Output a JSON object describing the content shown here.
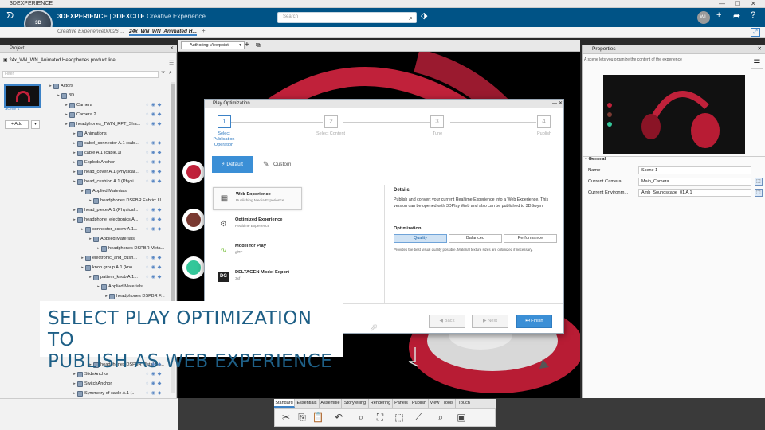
{
  "window": {
    "title": "3DEXPERIENCE",
    "controls": [
      "—",
      "☐",
      "✕"
    ]
  },
  "topbar": {
    "brand_main": "3DEXPERIENCE",
    "brand_sep": " | ",
    "brand_app": "3DEXCITE",
    "brand_sub": " Creative Experience",
    "search_placeholder": "Search",
    "compass_title": "3D",
    "compass_version": "V.R",
    "user_initials": "WL"
  },
  "doc_tabs": [
    {
      "label": "Creative Experience00026 ..."
    },
    {
      "label": "24x_WN_WN_Animated H..."
    }
  ],
  "doc_tab_add": "+",
  "left_panel": {
    "title": "Project",
    "root": "24x_WN_WN_Animated Headphones product line",
    "scene_label": "Scene 1",
    "add_label": "+ Add",
    "filter_placeholder": "Filter"
  },
  "tree": [
    {
      "label": "Actors",
      "indent": 0,
      "icons": ""
    },
    {
      "label": "3D",
      "indent": 1,
      "icons": ""
    },
    {
      "label": "Camera",
      "indent": 2,
      "icons": "◌◉◆"
    },
    {
      "label": "Camera 2",
      "indent": 2,
      "icons": "◌◉◆"
    },
    {
      "label": "headphones_TWIN_RPT_Sha...",
      "indent": 2,
      "icons": "◌◉◆"
    },
    {
      "label": "Animations",
      "indent": 3,
      "icons": ""
    },
    {
      "label": "cabel_connector A.1 (cab...",
      "indent": 3,
      "icons": "◌◉◆"
    },
    {
      "label": "cable A.1 (cable.1)",
      "indent": 3,
      "icons": "◌◉◆"
    },
    {
      "label": "ExplodeAnchor",
      "indent": 3,
      "icons": "◌◉◆"
    },
    {
      "label": "head_cover A.1 (Physical...",
      "indent": 3,
      "icons": "◌◉◆"
    },
    {
      "label": "head_cushion A.1 (Physi...",
      "indent": 3,
      "icons": "◌◉◆"
    },
    {
      "label": "Applied Materials",
      "indent": 4,
      "icons": ""
    },
    {
      "label": "headphones DSPBR Fabric: U...",
      "indent": 5,
      "icons": ""
    },
    {
      "label": "head_piece A.1 (Physical...",
      "indent": 3,
      "icons": "◌◉◆"
    },
    {
      "label": "headphone_electronics A...",
      "indent": 3,
      "icons": "◌◉◆"
    },
    {
      "label": "connector_screw A.1...",
      "indent": 4,
      "icons": "◌◉◆"
    },
    {
      "label": "Applied Materials",
      "indent": 5,
      "icons": ""
    },
    {
      "label": "headphones DSPBR Meta...",
      "indent": 6,
      "icons": ""
    },
    {
      "label": "electronic_and_cush...",
      "indent": 4,
      "icons": "◌◉◆"
    },
    {
      "label": "knob group A.1 (kno...",
      "indent": 4,
      "icons": "◌◉◆"
    },
    {
      "label": "pattern_knob A.1...",
      "indent": 5,
      "icons": "◌◉◆"
    },
    {
      "label": "Applied Materials",
      "indent": 6,
      "icons": ""
    },
    {
      "label": "headphones DSPBR F...",
      "indent": 7,
      "icons": ""
    }
  ],
  "tree_bottom": [
    {
      "label": "headphones DSPBR Metal Sa...",
      "indent": 5,
      "icons": "◌◉◆"
    },
    {
      "label": "SlideAnchor",
      "indent": 3,
      "icons": "◌◉◆"
    },
    {
      "label": "SwitchAnchor",
      "indent": 3,
      "icons": "◌◉◆"
    },
    {
      "label": "Symmetry of cable A.1 (...",
      "indent": 3,
      "icons": "◌◉◆"
    }
  ],
  "viewport": {
    "viewpoint_label": "Authoring Viewpoint"
  },
  "properties": {
    "title": "Properties",
    "hint": "A scene lets you organize the content of the experience",
    "section": "General",
    "rows": [
      {
        "label": "Name",
        "value": "Scene 1"
      },
      {
        "label": "Current Camera",
        "value": "Main_Camera"
      },
      {
        "label": "Current Environm...",
        "value": "Amb_Soundscape_01 A.1"
      }
    ]
  },
  "dialog": {
    "title": "Play Optimization",
    "steps": [
      {
        "num": "1",
        "label": "Select Publication Operation"
      },
      {
        "num": "2",
        "label": "Select Content"
      },
      {
        "num": "3",
        "label": "Tune"
      },
      {
        "num": "4",
        "label": "Publish"
      }
    ],
    "mode_default": "Default",
    "mode_custom": "Custom",
    "options": [
      {
        "title": "Web Experience",
        "sub": "Publishing Media Experience",
        "icon": "web-experience-icon"
      },
      {
        "title": "Optimized Experience",
        "sub": "Realtime Experience",
        "icon": "optimized-experience-icon"
      },
      {
        "title": "Model for Play",
        "sub": "glTF",
        "icon": "gltf-icon"
      },
      {
        "title": "DELTAGEN Model Export",
        "sub": "3xf",
        "icon": "deltagen-icon"
      }
    ],
    "details_title": "Details",
    "details_text": "Publish and convert your current Realtime Experience into a Web Experience. This version can be opened with 3DPlay Web and also can be published to 3DSwym.",
    "optimization_title": "Optimization",
    "opt_levels": [
      "Quality",
      "Balanced",
      "Performance"
    ],
    "opt_note": "Provides the best visual quality possible. Material texture sizes are optimized if necessary.",
    "back": "Back",
    "next": "Next",
    "finish": "Finish"
  },
  "caption": {
    "line1": "SELECT PLAY OPTIMIZATION TO",
    "line2": "PUBLISH AS WEB EXPERIENCE"
  },
  "bottom_tabs": [
    "Standard",
    "Essentials",
    "Assemble",
    "Storytelling",
    "Rendering",
    "Panels",
    "Publish",
    "View",
    "Tools",
    "Touch"
  ],
  "colors": {
    "topbar": "#005386",
    "accent": "#3b8fd6",
    "caption_text": "#1e5f86",
    "headphone_red": "#c0213a"
  }
}
